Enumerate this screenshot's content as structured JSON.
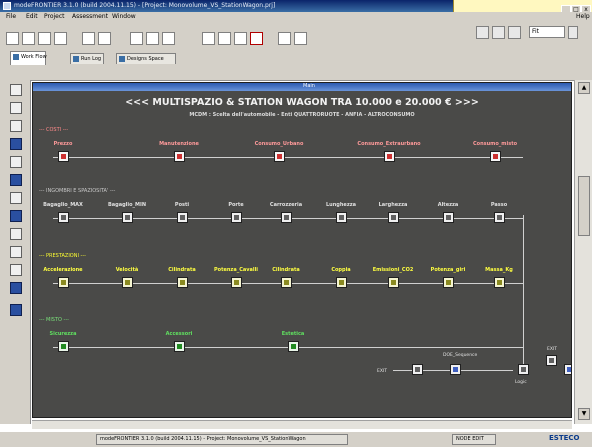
{
  "window": {
    "title": "modeFRONTIER 3.1.0 (build 2004.11.15) - [Project: Monovolume_VS_StationWagon.prj]",
    "min_label": "_",
    "max_label": "□",
    "close_label": "x"
  },
  "menu": {
    "items": [
      "File",
      "Edit",
      "Project",
      "Assessment",
      "Window"
    ],
    "help": "Help"
  },
  "toolbar": {
    "zoom_value": "Fit"
  },
  "tabs": [
    {
      "label": "Work Flow"
    },
    {
      "label": "Run Log"
    },
    {
      "label": "Designs Space"
    }
  ],
  "canvas": {
    "header_title": "Main",
    "title": "<<< MULTISPAZIO & STATION WAGON TRA 10.000 e 20.000 € >>>",
    "subtitle": "MCDM : Scelta dell'automobile - Enti QUATTRORUOTE - ANFIA - ALTROCONSUMO",
    "groups": [
      {
        "label": "--- COSTI ---",
        "color": "red",
        "vars": [
          "Prezzo",
          "Manutenzione",
          "Consumo_Urbano",
          "Consumo_Extraurbano",
          "Consumo_misto"
        ]
      },
      {
        "label": "--- INGOMBRI E SPAZIOSITA' ---",
        "color": "gray",
        "vars": [
          "Bagaglio_MAX",
          "Bagaglio_MIN",
          "Posti",
          "Porte",
          "Carrozzeria",
          "Lunghezza",
          "Larghezza",
          "Altezza",
          "Passo"
        ]
      },
      {
        "label": "--- PRESTAZIONI ---",
        "color": "yellow",
        "vars": [
          "Accelerazione",
          "Velocità",
          "Cilindrata",
          "Potenza_Cavalli",
          "Cilindrata",
          "Coppia",
          "Emissioni_CO2",
          "Potenza_giri",
          "Massa_Kg"
        ]
      },
      {
        "label": "--- MISTO ---",
        "color": "green",
        "vars": [
          "Sicurezza",
          "Accessori",
          "Estetica"
        ]
      }
    ],
    "flow": {
      "start_label": "EXIT",
      "script_label": "DOE_Sequence",
      "end_label": "EXIT",
      "logic_label": "Logic"
    }
  },
  "taskbar": {
    "items": [
      "modeFRONTIER 3.1.0 (build 2004.11.15) - Project: Monovolume_VS_StationWagon",
      "NODE EDIT"
    ],
    "brand": "ESTECO"
  }
}
